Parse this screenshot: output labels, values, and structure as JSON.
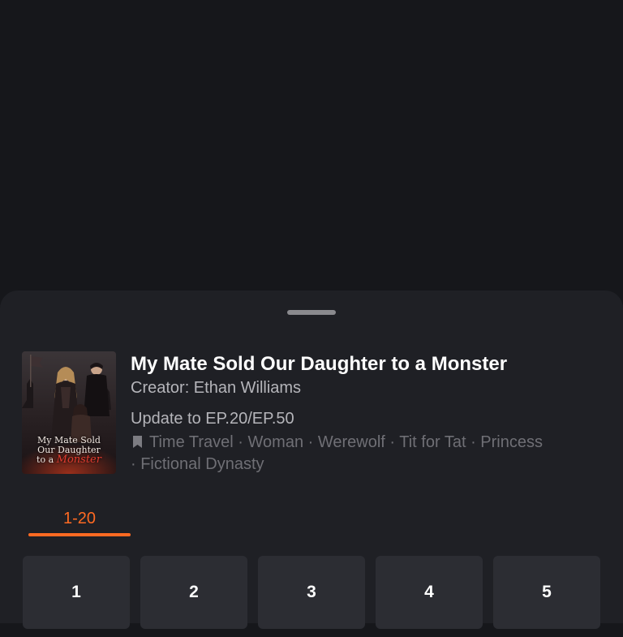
{
  "drama": {
    "title": "My Mate Sold Our Daughter to a Monster",
    "creator": "Creator: Ethan Williams",
    "update": "Update to EP.20/EP.50",
    "tags": [
      "Time Travel",
      "Woman",
      "Werewolf",
      "Tit for Tat",
      "Princess",
      "Fictional Dynasty"
    ],
    "cover_text": {
      "line1": "My Mate Sold",
      "line2": "Our Daughter",
      "line3_prefix": "to a ",
      "line3_accent": "Monster"
    }
  },
  "episode_range_tab": {
    "label": "1-20",
    "active": true
  },
  "episodes": [
    "1",
    "2",
    "3",
    "4",
    "5"
  ],
  "icons": {
    "grabber": "drag-handle-icon",
    "tags": "bookmark-icon"
  },
  "colors": {
    "accent": "#ff6a22",
    "sheet": "#1f2025",
    "tile": "#2c2d33"
  }
}
